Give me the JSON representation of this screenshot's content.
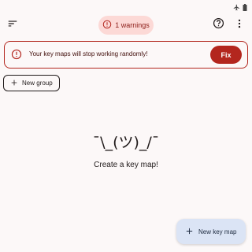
{
  "status_bar": {
    "icons": [
      "airplane-icon",
      "battery-icon"
    ]
  },
  "top_bar": {
    "menu_icon": "sort-icon",
    "warnings_label": "1 warnings",
    "help_icon": "help-icon",
    "more_icon": "more-vert-icon"
  },
  "banner": {
    "message": "Your key maps will stop working randomly!",
    "fix_label": "Fix"
  },
  "new_group_label": "New group",
  "empty_state": {
    "shrug": "¯\\_(ツ)_/¯",
    "message": "Create a key map!"
  },
  "fab_label": "New key map",
  "colors": {
    "error": "#b3261e",
    "error_container": "#fcd9d6",
    "fab_background": "#dbe4f5",
    "background": "#fcf8f8"
  }
}
